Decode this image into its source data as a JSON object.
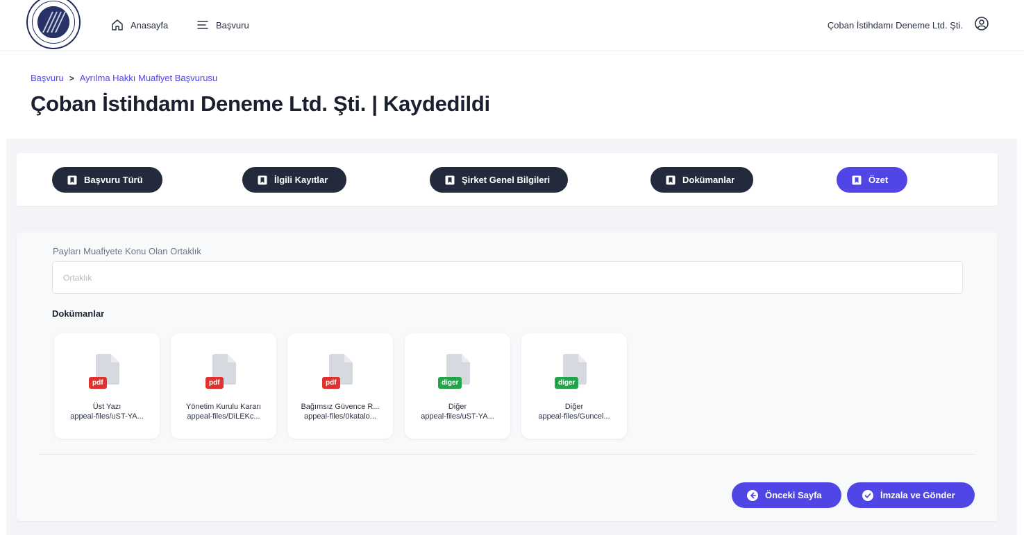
{
  "nav": {
    "home_label": "Anasayfa",
    "apply_label": "Başvuru",
    "user_name": "Çoban İstihdamı Deneme Ltd. Şti."
  },
  "breadcrumb": {
    "items": [
      "Başvuru",
      "Ayrılma Hakkı Muafiyet Başvurusu"
    ],
    "separator": ">"
  },
  "page": {
    "title": "Çoban İstihdamı Deneme Ltd. Şti. | Kaydedildi"
  },
  "steps": [
    {
      "label": "Başvuru Türü",
      "active": false
    },
    {
      "label": "İlgili Kayıtlar",
      "active": false
    },
    {
      "label": "Şirket Genel Bilgileri",
      "active": false
    },
    {
      "label": "Dokümanlar",
      "active": false
    },
    {
      "label": "Özet",
      "active": true
    }
  ],
  "form": {
    "partnership_label": "Payları Muafiyete Konu Olan Ortaklık",
    "partnership_value": "",
    "partnership_placeholder": "Ortaklık",
    "documents_title": "Dokümanlar"
  },
  "documents": [
    {
      "type": "pdf",
      "name": "Üst Yazı",
      "path": "appeal-files/uST-YA..."
    },
    {
      "type": "pdf",
      "name": "Yönetim Kurulu Kararı",
      "path": "appeal-files/DiLEKc..."
    },
    {
      "type": "pdf",
      "name": "Bağımsız Güvence R...",
      "path": "appeal-files/0katalo..."
    },
    {
      "type": "diger",
      "name": "Diğer",
      "path": "appeal-files/uST-YA..."
    },
    {
      "type": "diger",
      "name": "Diğer",
      "path": "appeal-files/Guncel..."
    }
  ],
  "actions": {
    "previous_label": "Önceki Sayfa",
    "sign_submit_label": "İmzala ve Gönder"
  },
  "icons": {
    "nav_home": "home-icon",
    "nav_apply": "menu-icon",
    "user": "user-circle-icon",
    "step": "bookmark-icon",
    "doc": "file-icon",
    "previous": "arrow-left-circle-icon",
    "submit": "check-circle-icon"
  },
  "colors": {
    "accent": "#5046e5",
    "dark_tab": "#222a3b",
    "pdf_badge": "#e0312f",
    "diger_badge": "#22a44b"
  }
}
